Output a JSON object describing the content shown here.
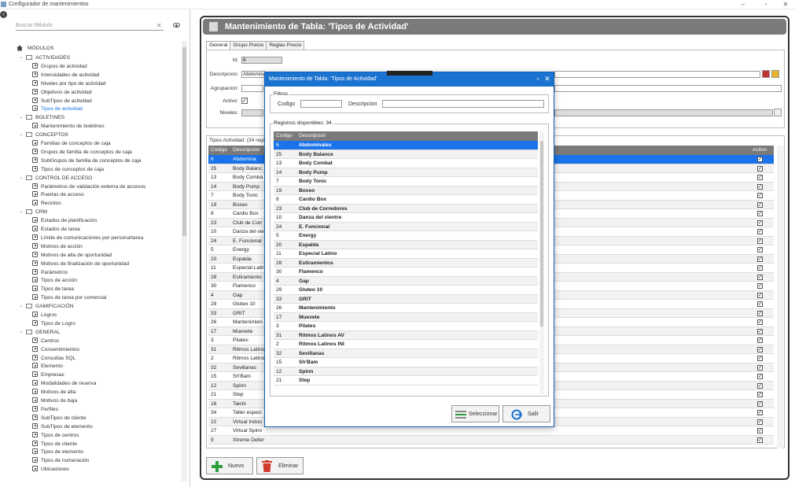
{
  "window": {
    "title": "Configurador de mantenimientos"
  },
  "left": {
    "search_placeholder": "Buscar Módulo",
    "root_label": "MÓDULOS",
    "tree": [
      {
        "label": "ACTIVIDADES",
        "type": "group"
      },
      {
        "label": "Grupos de actividad",
        "type": "item"
      },
      {
        "label": "Intensidades de actividad",
        "type": "item"
      },
      {
        "label": "Niveles por tipo de actividad",
        "type": "item"
      },
      {
        "label": "Objetivos de actividad",
        "type": "item"
      },
      {
        "label": "SubTipos de actividad",
        "type": "item"
      },
      {
        "label": "Tipos de actividad",
        "type": "item",
        "selected": true
      },
      {
        "label": "BOLETINES",
        "type": "group"
      },
      {
        "label": "Mantenimiento de boletines",
        "type": "item"
      },
      {
        "label": "CONCEPTOS",
        "type": "group"
      },
      {
        "label": "Familias de conceptos de caja",
        "type": "item"
      },
      {
        "label": "Grupos de familia de conceptos de caja",
        "type": "item"
      },
      {
        "label": "SubGrupos de familia de conceptos de caja",
        "type": "item"
      },
      {
        "label": "Tipos de conceptos de caja",
        "type": "item"
      },
      {
        "label": "CONTROL DE ACCESO",
        "type": "group"
      },
      {
        "label": "Parámetros de validación externa de accesos",
        "type": "item"
      },
      {
        "label": "Puertas de acceso",
        "type": "item"
      },
      {
        "label": "Recintos",
        "type": "item"
      },
      {
        "label": "CRM",
        "type": "group"
      },
      {
        "label": "Estados de planificación",
        "type": "item"
      },
      {
        "label": "Estados de tarea",
        "type": "item"
      },
      {
        "label": "Límite de comunicaciones por persona/tarea",
        "type": "item"
      },
      {
        "label": "Motivos de acción",
        "type": "item"
      },
      {
        "label": "Motivos de alta de oportunidad",
        "type": "item"
      },
      {
        "label": "Motivos de finalización de oportunidad",
        "type": "item"
      },
      {
        "label": "Parámetros",
        "type": "item"
      },
      {
        "label": "Tipos de acción",
        "type": "item"
      },
      {
        "label": "Tipos de tarea",
        "type": "item"
      },
      {
        "label": "Tipos de tarea por comercial",
        "type": "item"
      },
      {
        "label": "GAMIFICACIÓN",
        "type": "group"
      },
      {
        "label": "Logros",
        "type": "item"
      },
      {
        "label": "Tipos de Logro",
        "type": "item"
      },
      {
        "label": "GENERAL",
        "type": "group"
      },
      {
        "label": "Centros",
        "type": "item"
      },
      {
        "label": "Consentimientos",
        "type": "item"
      },
      {
        "label": "Consultas SQL",
        "type": "item"
      },
      {
        "label": "Elemento",
        "type": "item"
      },
      {
        "label": "Empresas",
        "type": "item"
      },
      {
        "label": "Modalidades de reserva",
        "type": "item"
      },
      {
        "label": "Motivos de alta",
        "type": "item"
      },
      {
        "label": "Motivos de baja",
        "type": "item"
      },
      {
        "label": "Perfiles",
        "type": "item"
      },
      {
        "label": "SubTipos de cliente",
        "type": "item"
      },
      {
        "label": "SubTipos de elemento",
        "type": "item"
      },
      {
        "label": "Tipos de centros",
        "type": "item"
      },
      {
        "label": "Tipos de cliente",
        "type": "item"
      },
      {
        "label": "Tipos de elemento",
        "type": "item"
      },
      {
        "label": "Tipos de numeración",
        "type": "item"
      },
      {
        "label": "Ubicaciones",
        "type": "item"
      }
    ]
  },
  "main": {
    "title": "Mantenimiento de Tabla: 'Tipos de Actividad'",
    "tabs": [
      "General",
      "Grupo Precio",
      "Reglas Precio"
    ],
    "form": {
      "id_label": "Id:",
      "id_value": "6",
      "descripcion_label": "Descripcion:",
      "descripcion_value": "Abdomina",
      "agrupacion_label": "Agrupacion:",
      "activo_label": "Activo:",
      "activo_mark": "✓",
      "niveles_label": "Niveles:"
    },
    "grid_caption": "Tipos Actividad: (34 regi",
    "grid_headers": {
      "codigo": "Código",
      "descripcion": "Descripcion",
      "activo": "Activo"
    },
    "check_mark": "✓",
    "grid_rows": [
      {
        "codigo": "6",
        "descripcion": "Abdomina"
      },
      {
        "codigo": "25",
        "descripcion": "Body Balanc"
      },
      {
        "codigo": "13",
        "descripcion": "Body Comba"
      },
      {
        "codigo": "14",
        "descripcion": "Body Pump"
      },
      {
        "codigo": "7",
        "descripcion": "Body Tonic"
      },
      {
        "codigo": "19",
        "descripcion": "Boxeo"
      },
      {
        "codigo": "8",
        "descripcion": "Cardio Box"
      },
      {
        "codigo": "23",
        "descripcion": "Club de Corr"
      },
      {
        "codigo": "10",
        "descripcion": "Danza del vie"
      },
      {
        "codigo": "24",
        "descripcion": "E. Funcional"
      },
      {
        "codigo": "5",
        "descripcion": "Energy"
      },
      {
        "codigo": "20",
        "descripcion": "Espalda"
      },
      {
        "codigo": "11",
        "descripcion": "Especial Latin"
      },
      {
        "codigo": "28",
        "descripcion": "Estiramiento"
      },
      {
        "codigo": "30",
        "descripcion": "Flamenco"
      },
      {
        "codigo": "4",
        "descripcion": "Gap"
      },
      {
        "codigo": "29",
        "descripcion": "Gluteo 10"
      },
      {
        "codigo": "33",
        "descripcion": "GRIT"
      },
      {
        "codigo": "26",
        "descripcion": "Mantenimien"
      },
      {
        "codigo": "17",
        "descripcion": "Muevete"
      },
      {
        "codigo": "3",
        "descripcion": "Pilates"
      },
      {
        "codigo": "31",
        "descripcion": "Ritmos Latino"
      },
      {
        "codigo": "2",
        "descripcion": "Ritmos Latino"
      },
      {
        "codigo": "32",
        "descripcion": "Sevillanas"
      },
      {
        "codigo": "15",
        "descripcion": "Sh'Bam"
      },
      {
        "codigo": "12",
        "descripcion": "Spinn"
      },
      {
        "codigo": "21",
        "descripcion": "Step"
      },
      {
        "codigo": "18",
        "descripcion": "Taichi"
      },
      {
        "codigo": "34",
        "descripcion": "Taller especi"
      },
      {
        "codigo": "22",
        "descripcion": "Virtual Indoo"
      },
      {
        "codigo": "27",
        "descripcion": "Virtual Spinn"
      },
      {
        "codigo": "9",
        "descripcion": "Xtreme Defensa"
      }
    ],
    "buttons": {
      "nuevo": "Nuevo",
      "eliminar": "Eliminar"
    }
  },
  "modal": {
    "title": "Mantenimiento de Tabla: 'Tipos de Actividad'",
    "filters_legend": "Filtros",
    "codigo_label": "Codigo",
    "descripcion_label": "Descripcion",
    "registros_legend": "Registros disponibles: 34",
    "headers": {
      "codigo": "Codigo",
      "descripcion": "Descripcion"
    },
    "rows": [
      {
        "codigo": "6",
        "descripcion": "Abdominales"
      },
      {
        "codigo": "25",
        "descripcion": "Body Balance"
      },
      {
        "codigo": "13",
        "descripcion": "Body Combat"
      },
      {
        "codigo": "14",
        "descripcion": "Body Pump"
      },
      {
        "codigo": "7",
        "descripcion": "Body Tonic"
      },
      {
        "codigo": "19",
        "descripcion": "Boxeo"
      },
      {
        "codigo": "8",
        "descripcion": "Cardio Box"
      },
      {
        "codigo": "23",
        "descripcion": "Club de Corredores"
      },
      {
        "codigo": "10",
        "descripcion": "Danza del vientre"
      },
      {
        "codigo": "24",
        "descripcion": "E. Funcional"
      },
      {
        "codigo": "5",
        "descripcion": "Energy"
      },
      {
        "codigo": "20",
        "descripcion": "Espalda"
      },
      {
        "codigo": "11",
        "descripcion": "Especial Latino"
      },
      {
        "codigo": "28",
        "descripcion": "Estiramientos"
      },
      {
        "codigo": "30",
        "descripcion": "Flamenco"
      },
      {
        "codigo": "4",
        "descripcion": "Gap"
      },
      {
        "codigo": "29",
        "descripcion": "Gluteo 10"
      },
      {
        "codigo": "33",
        "descripcion": "GRIT"
      },
      {
        "codigo": "26",
        "descripcion": "Mantenimiento"
      },
      {
        "codigo": "17",
        "descripcion": "Muevete"
      },
      {
        "codigo": "3",
        "descripcion": "Pilates"
      },
      {
        "codigo": "31",
        "descripcion": "Ritmos Latinos AV"
      },
      {
        "codigo": "2",
        "descripcion": "Ritmos Latinos INI"
      },
      {
        "codigo": "32",
        "descripcion": "Sevillanas"
      },
      {
        "codigo": "15",
        "descripcion": "Sh'Bam"
      },
      {
        "codigo": "12",
        "descripcion": "Spinn"
      },
      {
        "codigo": "21",
        "descripcion": "Step"
      }
    ],
    "buttons": {
      "seleccionar": "Seleccionar",
      "salir": "Salir"
    }
  },
  "colors": {
    "selection": "#1a73e8",
    "modal_title": "#1a73d0",
    "header_gray": "#7a7a7a",
    "add_green": "#2e9e3e",
    "delete_red": "#d33a2c"
  }
}
